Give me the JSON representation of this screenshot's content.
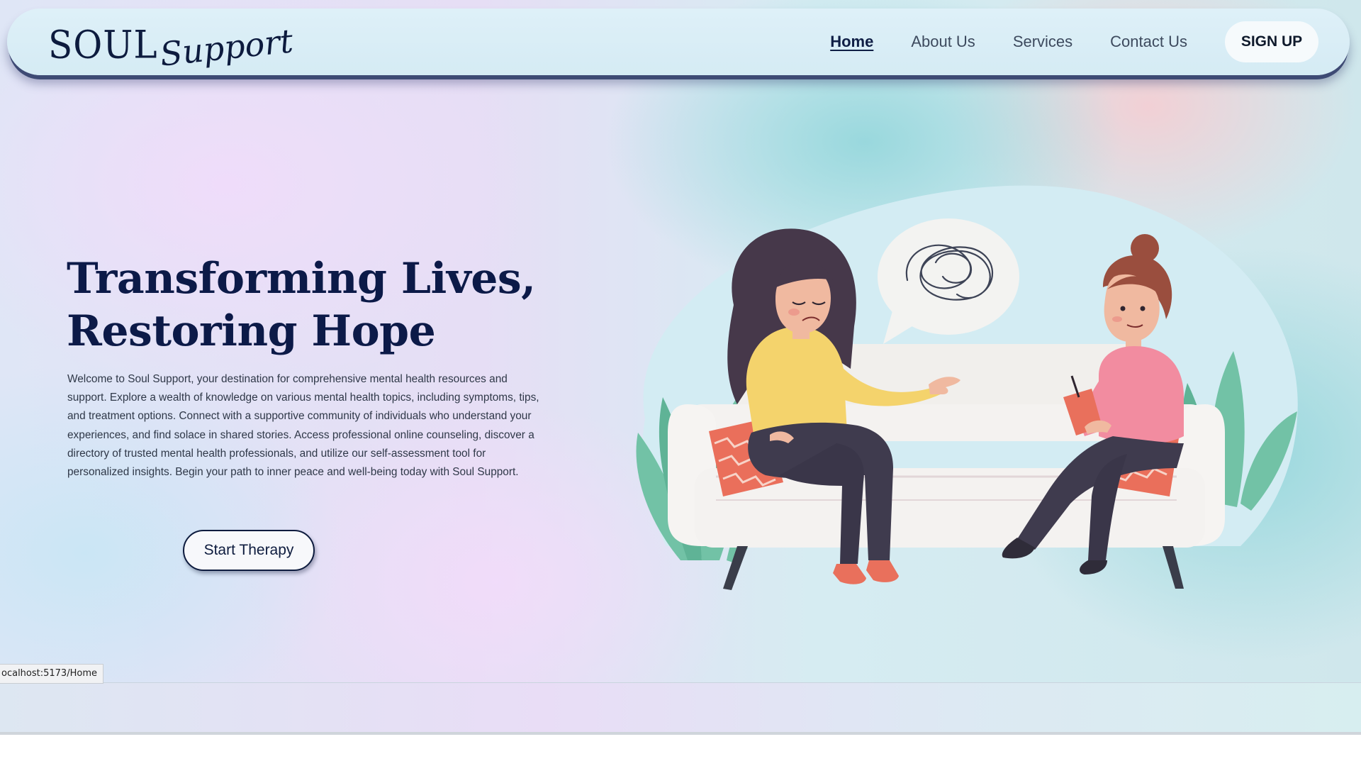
{
  "brand": {
    "name_primary": "SOUL",
    "name_script": "Support",
    "logo_icon": "brain-heart-icon"
  },
  "nav": {
    "items": [
      {
        "label": "Home",
        "active": true
      },
      {
        "label": "About Us",
        "active": false
      },
      {
        "label": "Services",
        "active": false
      },
      {
        "label": "Contact Us",
        "active": false
      }
    ],
    "signup_label": "SIGN UP"
  },
  "hero": {
    "title_line1": "Transforming Lives,",
    "title_line2": "Restoring Hope",
    "description": "Welcome to Soul Support, your destination for comprehensive mental health resources and support. Explore a wealth of knowledge on various mental health topics, including symptoms, tips, and treatment options. Connect with a supportive community of individuals who understand your experiences, and find solace in shared stories. Access professional online counseling, discover a directory of trusted mental health professionals, and utilize our self-assessment tool for personalized insights. Begin your path to inner peace and well-being today with Soul Support.",
    "cta_label": "Start Therapy"
  },
  "illustration": {
    "name": "therapy-session-illustration"
  },
  "status_bar": {
    "url": "ocalhost:5173/Home"
  },
  "colors": {
    "navy": "#0c1a48",
    "navbar_bg": "#d8edf6",
    "teal_leaf": "#6fc2a8",
    "sofa": "#f4f2f0",
    "cushion": "#e9705c",
    "pink_top": "#f28ca0",
    "yellow_top": "#f4d36c"
  }
}
